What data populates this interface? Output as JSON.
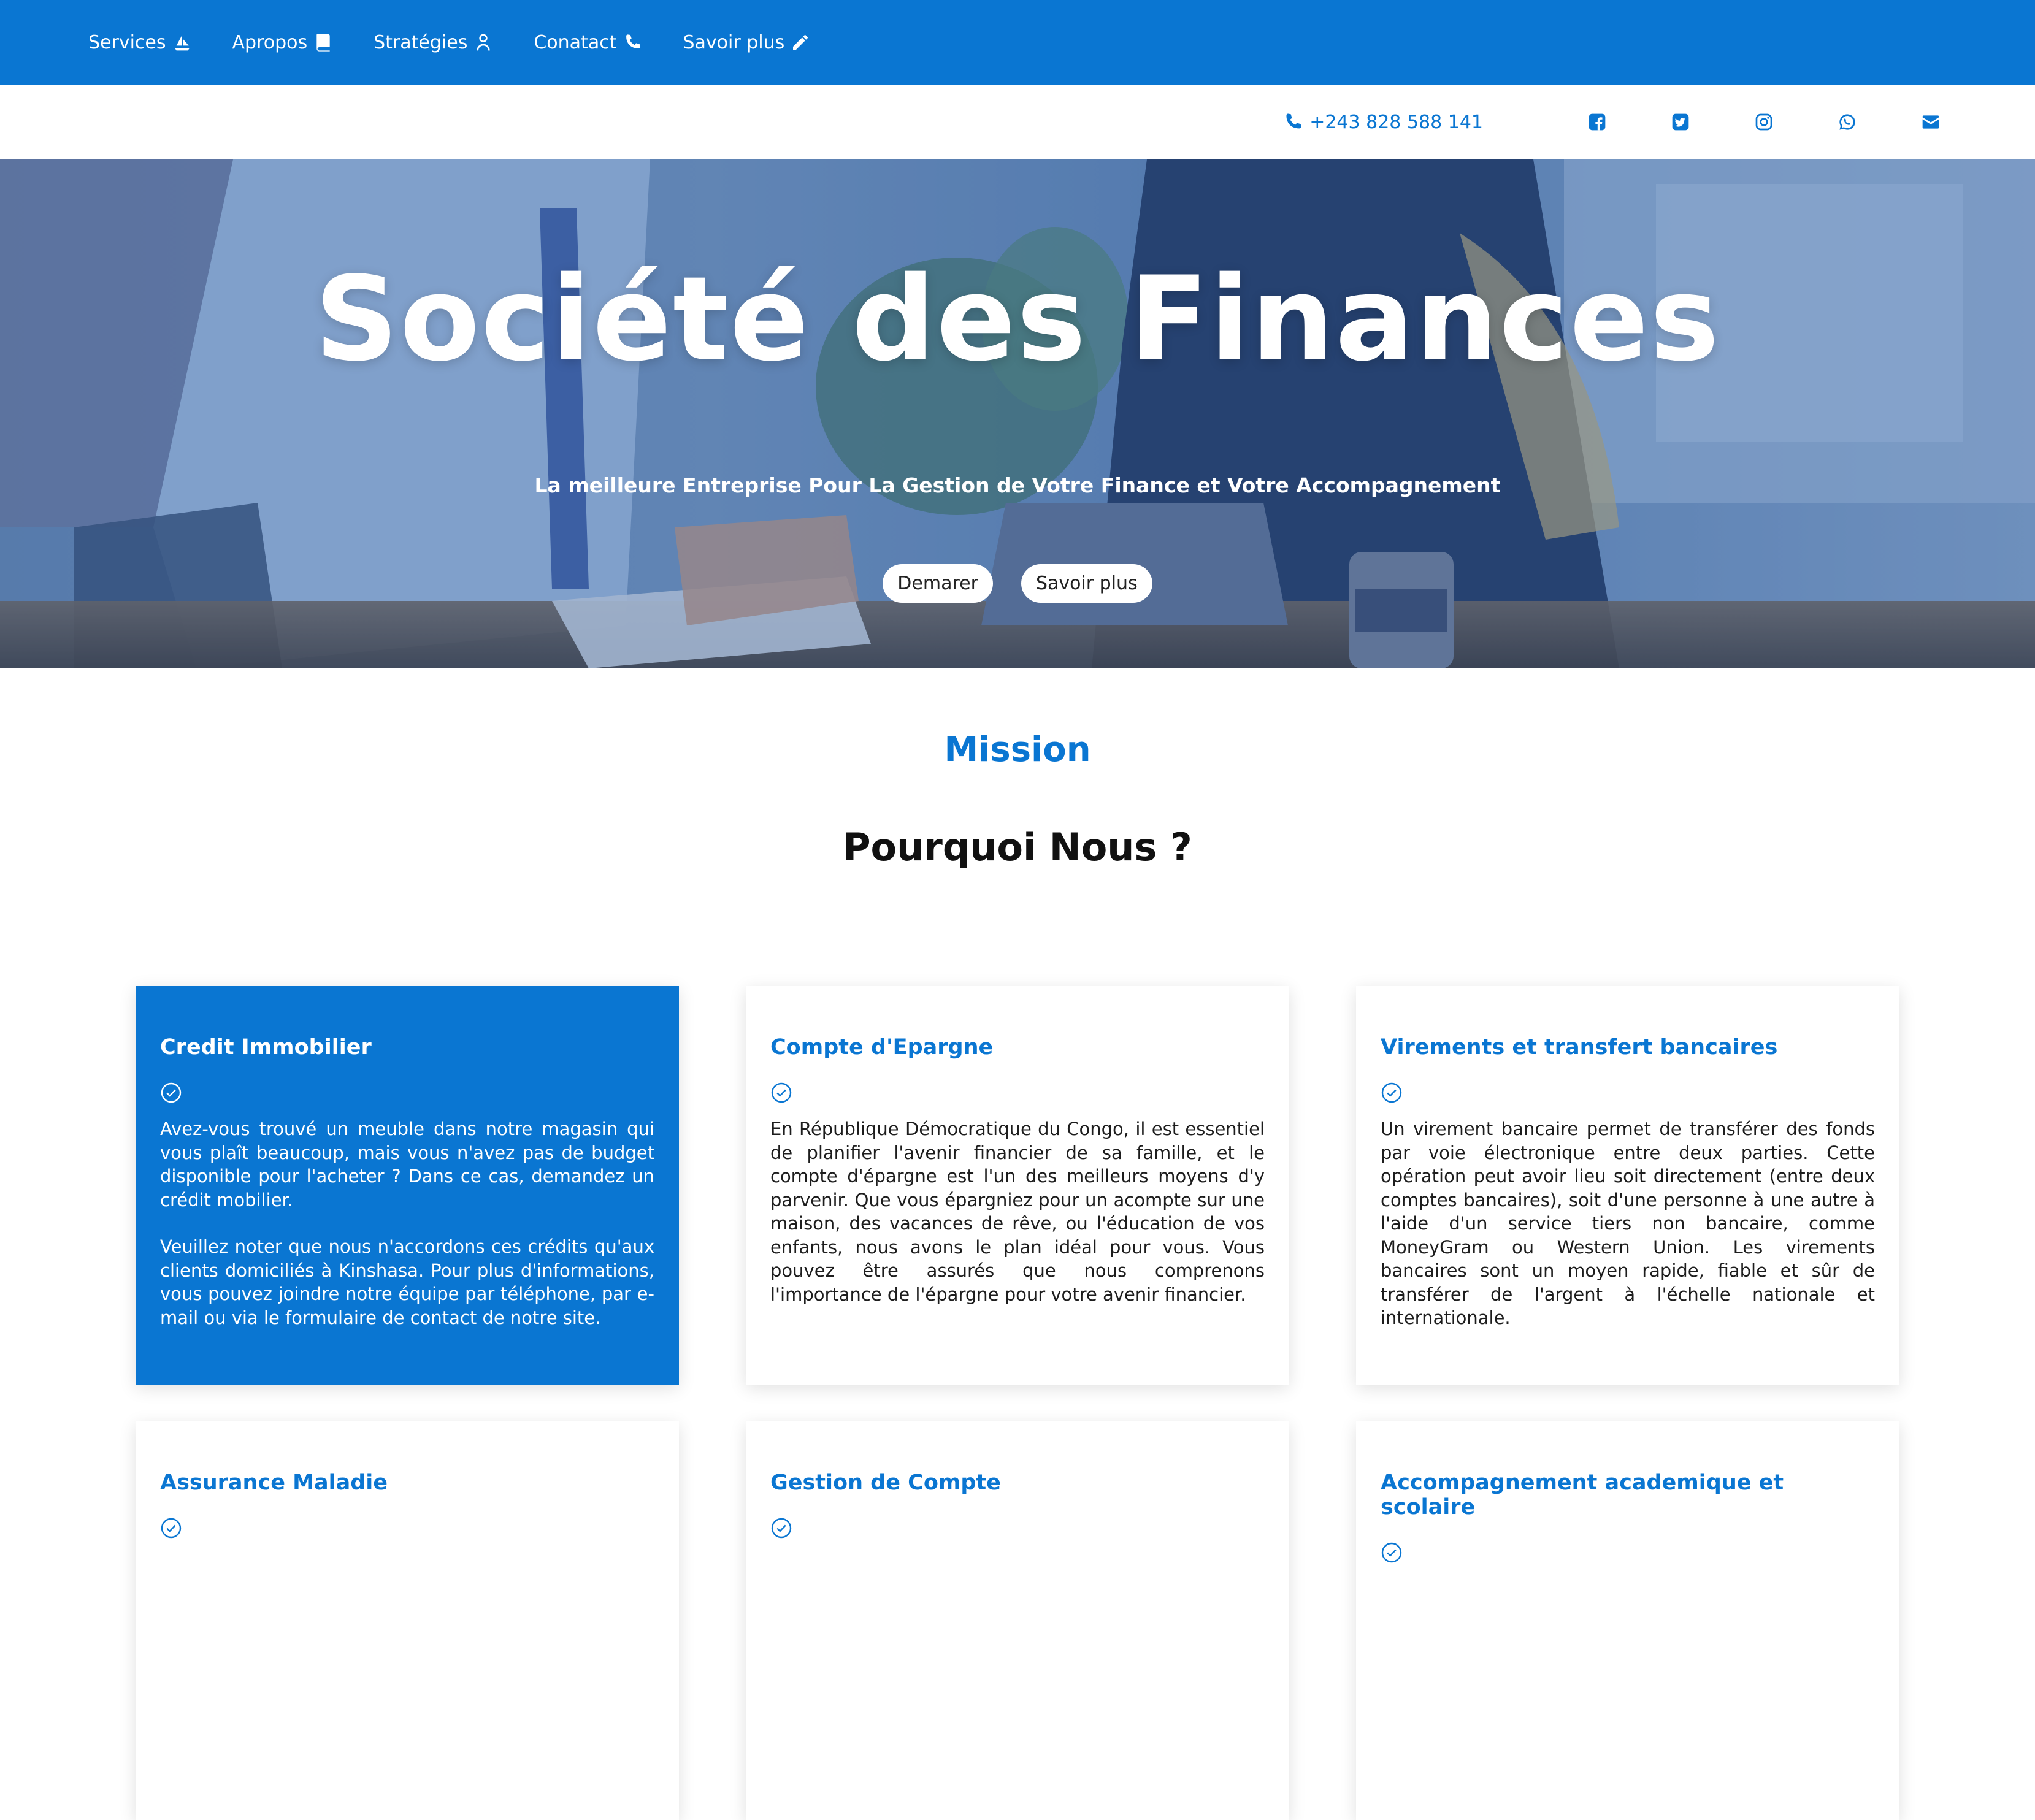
{
  "nav": {
    "items": [
      {
        "label": "Services",
        "icon": "ship-icon"
      },
      {
        "label": "Apropos",
        "icon": "book-icon"
      },
      {
        "label": "Stratégies",
        "icon": "user-icon"
      },
      {
        "label": "Conatact",
        "icon": "phone-icon"
      },
      {
        "label": "Savoir plus",
        "icon": "pencil-icon"
      }
    ]
  },
  "contact": {
    "phone": "+243 828 588 141",
    "socials": [
      "facebook-icon",
      "twitter-icon",
      "instagram-icon",
      "whatsapp-icon",
      "envelope-icon"
    ]
  },
  "hero": {
    "title": "Société des Finances",
    "subtitle": "La meilleure Entreprise Pour La Gestion de Votre Finance et Votre Accompagnement",
    "btn_start": "Demarer",
    "btn_more": "Savoir plus"
  },
  "section": {
    "eyebrow": "Mission",
    "title": "Pourquoi Nous ?"
  },
  "cards": [
    {
      "title": "Credit Immobilier",
      "paragraphs": [
        "Avez-vous trouvé un meuble dans notre magasin qui vous plaît beaucoup, mais vous n'avez pas de budget disponible pour l'acheter ? Dans ce cas, demandez un crédit mobilier.",
        "Veuillez noter que nous n'accordons ces crédits qu'aux clients domiciliés à Kinshasa. Pour plus d'informations, vous pouvez joindre notre équipe par téléphone, par e-mail ou via le formulaire de contact de notre site."
      ]
    },
    {
      "title": "Compte d'Epargne",
      "paragraphs": [
        "En République Démocratique du Congo, il est essentiel de planifier l'avenir financier de sa famille, et le compte d'épargne est l'un des meilleurs moyens d'y parvenir. Que vous épargniez pour un acompte sur une maison, des vacances de rêve, ou l'éducation de vos enfants, nous avons le plan idéal pour vous. Vous pouvez être assurés que nous comprenons l'importance de l'épargne pour votre avenir financier."
      ]
    },
    {
      "title": "Virements et transfert bancaires",
      "paragraphs": [
        "Un virement bancaire permet de transférer des fonds par voie électronique entre deux parties. Cette opération peut avoir lieu soit directement (entre deux comptes bancaires), soit d'une personne à une autre à l'aide d'un service tiers non bancaire, comme MoneyGram ou Western Union. Les virements bancaires sont un moyen rapide, fiable et sûr de transférer de l'argent à l'échelle nationale et internationale."
      ]
    },
    {
      "title": "Assurance Maladie",
      "paragraphs": []
    },
    {
      "title": "Gestion de Compte",
      "paragraphs": []
    },
    {
      "title": "Accompagnement academique et scolaire",
      "paragraphs": []
    }
  ],
  "colors": {
    "brand": "#0a76d2",
    "white": "#ffffff"
  }
}
